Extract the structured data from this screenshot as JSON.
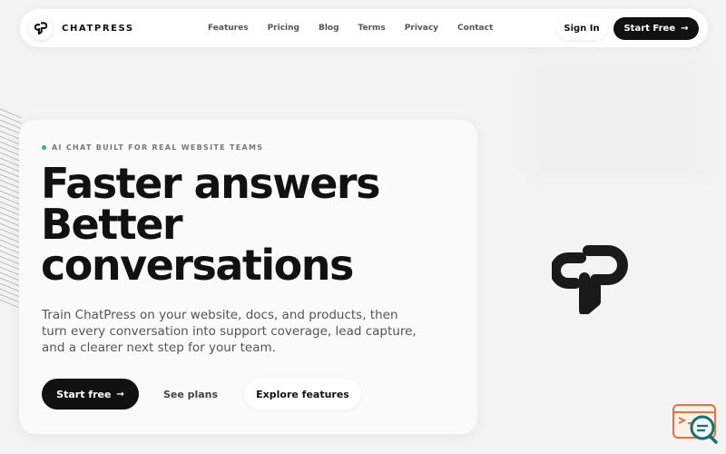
{
  "brand": {
    "name": "CHATPRESS",
    "logo_icon": "chatpress-logo-icon"
  },
  "nav": {
    "links": [
      "Features",
      "Pricing",
      "Blog",
      "Terms",
      "Privacy",
      "Contact"
    ],
    "sign_in": "Sign In",
    "start_free": "Start Free",
    "arrow": "→"
  },
  "hero": {
    "eyebrow": "AI CHAT BUILT FOR REAL WEBSITE TEAMS",
    "headline": [
      "Faster answers",
      "Better",
      "conversations"
    ],
    "description": "Train ChatPress on your website, docs, and products, then turn every conversation into support coverage, lead capture, and a clearer next step for your team.",
    "cta_primary": "Start free",
    "cta_secondary": "See plans",
    "cta_tertiary": "Explore features",
    "arrow": "→"
  },
  "colors": {
    "accent_dot": "#2fb56a",
    "dark": "#111111",
    "widget_orange": "#e8743b",
    "widget_teal": "#1a6e73"
  }
}
